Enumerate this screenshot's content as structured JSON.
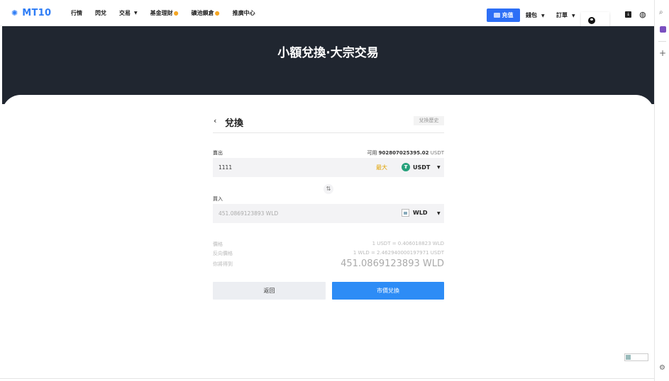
{
  "nav": {
    "logo": "MT10",
    "items": [
      {
        "label": "行情"
      },
      {
        "label": "閃兌"
      },
      {
        "label": "交易",
        "dropdown": true
      },
      {
        "label": "基金理財",
        "hot": true
      },
      {
        "label": "礦池鎖倉",
        "hot": true
      },
      {
        "label": "推廣中心"
      }
    ],
    "deposit": "充值",
    "wallet": "錢包",
    "orders": "訂單"
  },
  "hero": {
    "title": "小額兌換·大宗交易"
  },
  "card": {
    "title": "兌換",
    "history": "兌換歷史",
    "sell_label": "賣出",
    "available_prefix": "可用",
    "available_amount": "902807025395.02",
    "available_unit": "USDT",
    "sell_value": "1111",
    "max": "最大",
    "sell_coin": "USDT",
    "buy_label": "買入",
    "buy_value": "451.0869123893 WLD",
    "buy_coin": "WLD",
    "price_label": "價格",
    "price_value": "1 USDT = 0.406018823 WLD",
    "inverse_label": "反向價格",
    "inverse_value": "1 WLD = 2.462940000197971 USDT",
    "receive_label": "你將得到",
    "receive_value": "451.0869123893 WLD",
    "back_button": "返回",
    "convert_button": "市價兌換"
  },
  "colors": {
    "accent": "#2d6ff6",
    "hero_bg": "#202630",
    "max": "#e0a100",
    "usdt": "#26a17b"
  }
}
